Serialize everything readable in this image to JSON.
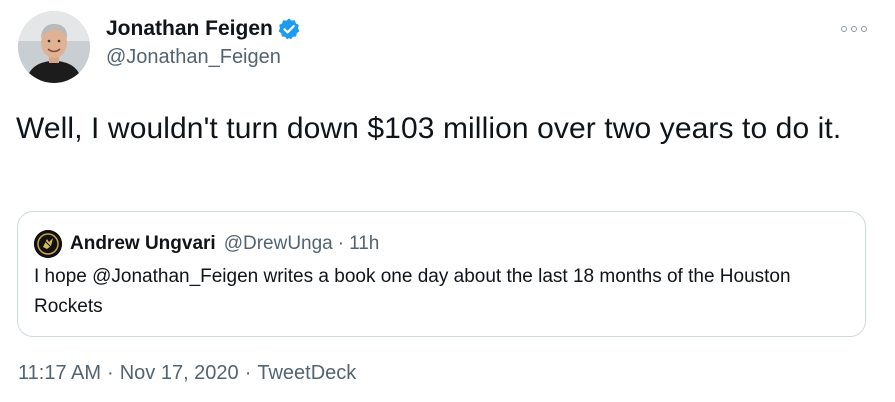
{
  "author": {
    "name": "Jonathan Feigen",
    "handle": "@Jonathan_Feigen",
    "verified": true
  },
  "tweet": {
    "text": "Well, I wouldn't turn down $103 million over two years to do it."
  },
  "quoted_tweet": {
    "name": "Andrew Ungvari",
    "handle": "@DrewUnga",
    "separator": "·",
    "time": "11h",
    "text": "I hope @Jonathan_Feigen writes a book one day about the last 18 months of the Houston Rockets"
  },
  "meta": {
    "time": "11:17 AM",
    "date": "Nov 17, 2020",
    "source": "TweetDeck",
    "separator": "·"
  },
  "colors": {
    "verified": "#1d9bf0",
    "secondary_text": "#536471",
    "border": "#cfd9de"
  }
}
